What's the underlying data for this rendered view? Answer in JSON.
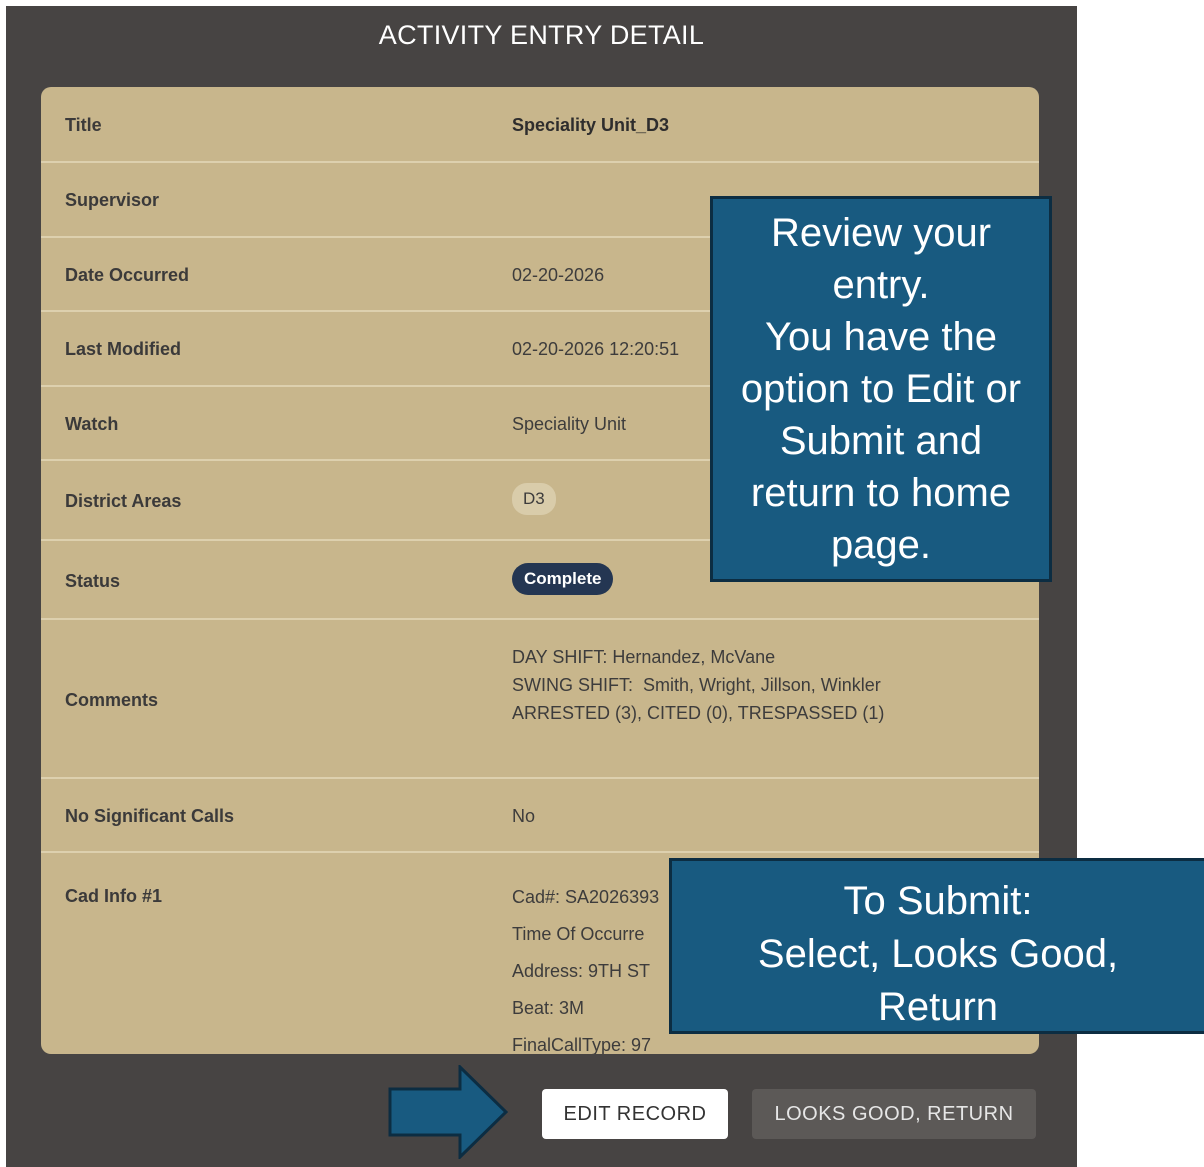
{
  "header": {
    "title": "ACTIVITY ENTRY DETAIL"
  },
  "fields": {
    "title": {
      "label": "Title",
      "value": "Speciality Unit_D3"
    },
    "supervisor": {
      "label": "Supervisor",
      "value": ""
    },
    "date_occurred": {
      "label": "Date Occurred",
      "value": "02-20-2026"
    },
    "last_modified": {
      "label": "Last Modified",
      "value": "02-20-2026 12:20:51"
    },
    "watch": {
      "label": "Watch",
      "value": "Speciality Unit"
    },
    "district_areas": {
      "label": "District Areas",
      "value": "D3"
    },
    "status": {
      "label": "Status",
      "value": "Complete"
    },
    "comments": {
      "label": "Comments",
      "lines": [
        "DAY SHIFT: Hernandez, McVane",
        "SWING SHIFT:  Smith, Wright, Jillson, Winkler",
        "ARRESTED (3), CITED (0), TRESPASSED (1)"
      ]
    },
    "no_significant_calls": {
      "label": "No Significant Calls",
      "value": "No"
    },
    "cad_info": {
      "label": "Cad Info #1",
      "lines": [
        "Cad#: SA2026393",
        "Time Of Occurre",
        "Address: 9TH ST",
        "Beat: 3M",
        "FinalCallType: 97"
      ]
    }
  },
  "callouts": {
    "review": [
      "Review your",
      "entry.",
      "You have the",
      "option to Edit or",
      "Submit and",
      "return to home",
      "page."
    ],
    "submit": [
      "To Submit:",
      "Select, Looks Good,",
      "Return"
    ]
  },
  "buttons": {
    "edit": "EDIT RECORD",
    "looks_good": "LOOKS GOOD, RETURN"
  },
  "colors": {
    "panel": "#474443",
    "card": "#c8b68c",
    "status_pill": "#243652",
    "callout": "#185a80",
    "arrow": "#185a80"
  },
  "icons": {
    "pointer_arrow": "right-arrow-icon"
  }
}
